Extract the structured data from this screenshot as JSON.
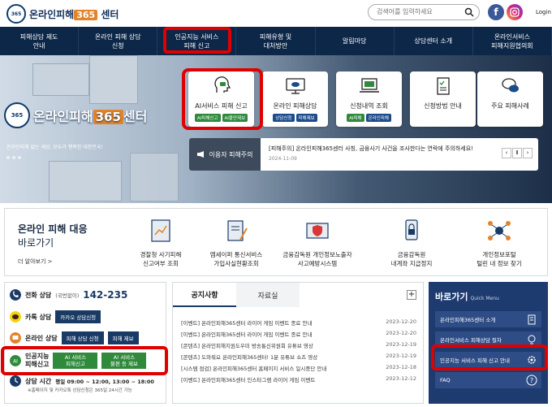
{
  "header": {
    "logo_badge": "365",
    "logo_prefix": "온라인피해",
    "logo_num": "365",
    "logo_suffix": "센터",
    "search_placeholder": "검색어를 입력하세요",
    "login": "Login"
  },
  "nav": [
    "피해상담 제도\n안내",
    "온라인 피해 상담\n신청",
    "인공지능 서비스\n피해 신고",
    "피해유형 및\n대처방안",
    "알림마당",
    "상담센터 소개",
    "온라인서비스\n피해지원협의회"
  ],
  "hero": {
    "logo_prefix": "온라인피해",
    "logo_num": "365",
    "logo_suffix": "센터",
    "subtitle": "온라인피해 없는 세상, 모두가 행복한 대한민국!",
    "cards": [
      {
        "title": "AI서비스 피해 신고",
        "tags": [
          "AI피해신고",
          "AI불만제보"
        ]
      },
      {
        "title": "온라인 피해상담",
        "tags": [
          "상담신청",
          "피해제보"
        ]
      },
      {
        "title": "신청내역 조회",
        "tags": [
          "AI피해",
          "온라인피해"
        ]
      },
      {
        "title": "신청방법 안내",
        "tags": []
      },
      {
        "title": "주요 피해사례",
        "tags": []
      }
    ],
    "notice_label": "이용자 피해주의",
    "notice_msg": "[피해주의] 온라인피해365센터 사칭, 금융사기 사건을 조사한다는 연락에 주의하세요!",
    "notice_date": "2024-11-09"
  },
  "band": {
    "title": "온라인 피해 대응",
    "subtitle": "바로가기",
    "more": "더 알아보기 >",
    "services": [
      "경찰청 사기피해\n신고여부 조회",
      "엠세이퍼 통신서비스\n가입사실현황조회",
      "금융감독원 개인정보노출자\n사고예방시스템",
      "금융감독원\n내계좌 지급정지",
      "개인정보포털\n털린 내 정보 찾기"
    ]
  },
  "left": {
    "phone_label": "전화 상담",
    "phone_sub": "(국번없이)",
    "phone_num": "142-235",
    "kakao_label": "카톡 상담",
    "kakao_btn": "카카오 상담신청",
    "online_label": "온라인 상담",
    "online_btn1": "피해 상담 신청",
    "online_btn2": "피해 제보",
    "ai_label": "인공지능\n피해신고",
    "ai_btn1": "AI 서비스\n피해신고",
    "ai_btn2": "AI 서비스\n불편 등 제보",
    "hours_label": "상담 시간",
    "hours_val": "평일 09:00 ~ 12:00, 13:00 ~ 18:00",
    "hours_note": "※홈페이지 및 카카오톡 상담신청은 365일 24시간 가능"
  },
  "board": {
    "tab1": "공지사항",
    "tab2": "자료실",
    "plus": "+",
    "items": [
      {
        "t": "[이벤트] 온라인피해365센터 라이어 게임 이벤트 종료 안내",
        "d": "2023-12-20"
      },
      {
        "t": "[이벤트] 온라인피해365센터 라이어 게임 이벤트 종료 안내",
        "d": "2023-12-20"
      },
      {
        "t": "[콘텐츠] 온라인피해지원도우미 방송통신위원회 유튜브 영상",
        "d": "2023-12-19"
      },
      {
        "t": "[콘텐츠] 도와줘요 온라인피해365센터! 1분 유튜브 쇼츠 영상",
        "d": "2023-12-19"
      },
      {
        "t": "[시스템 점검] 온라인피해365센터 홈페이지 서비스 일시중단 안내",
        "d": "2023-12-18"
      },
      {
        "t": "[이벤트] 온라인피해365센터 인스타그램 라이어 게임 이벤트",
        "d": "2023-12-12"
      }
    ]
  },
  "quick": {
    "title": "바로가기",
    "title_sub": "Quick Menu",
    "items": [
      "온라인피해365센터 소개",
      "온라인서비스 피해상담 절차",
      "인공지능 서비스 피해 신고 안내",
      "FAQ"
    ]
  },
  "colors": {
    "navy": "#0c2748",
    "green": "#2f8a3c",
    "highlight": "#e00000"
  }
}
